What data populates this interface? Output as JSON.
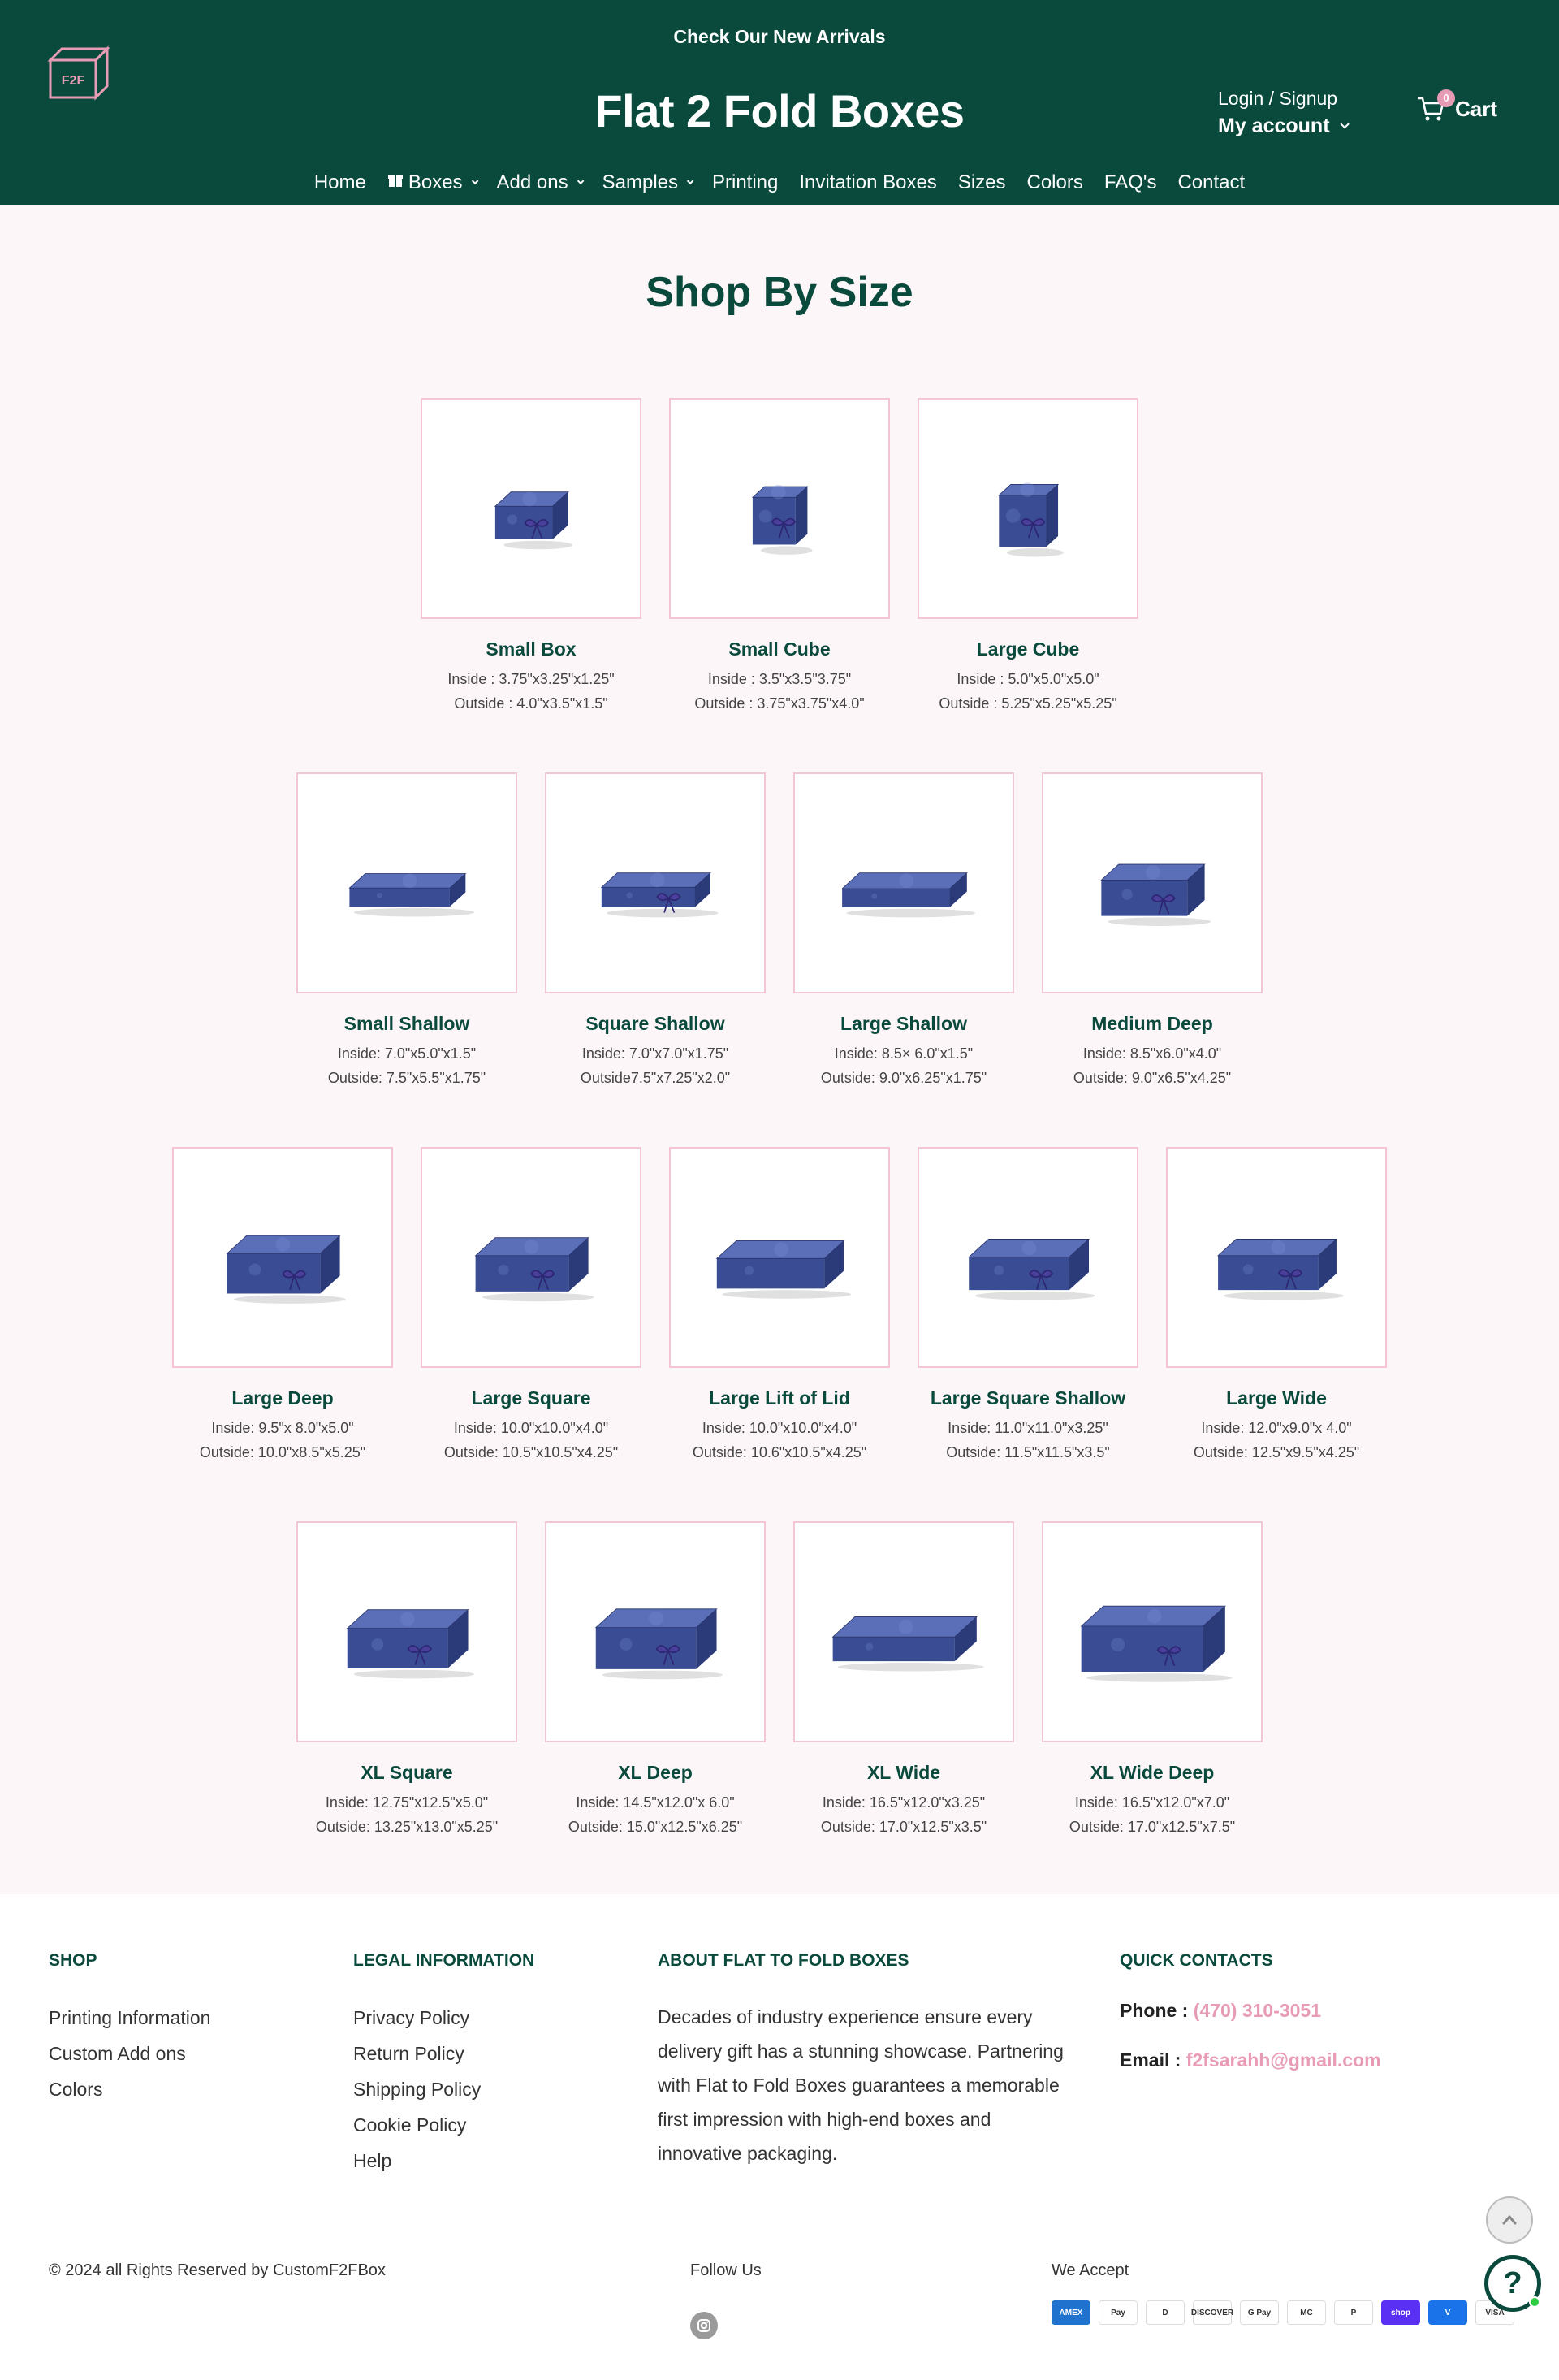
{
  "header": {
    "announcement": "Check Our New Arrivals",
    "logo_text": "F2F",
    "brand": "Flat 2 Fold Boxes",
    "login": "Login / Signup",
    "my_account": "My account",
    "cart_label": "Cart",
    "cart_count": "0"
  },
  "nav": [
    "Home",
    "Boxes",
    "Add ons",
    "Samples",
    "Printing",
    "Invitation Boxes",
    "Sizes",
    "Colors",
    "FAQ's",
    "Contact"
  ],
  "main": {
    "title": "Shop By Size",
    "products": [
      {
        "name": "Small Box",
        "inside": "Inside : 3.75\"x3.25\"x1.25\"",
        "outside": "Outside : 4.0\"x3.5\"x1.5\""
      },
      {
        "name": "Small Cube",
        "inside": "Inside : 3.5\"x3.5\"3.75\"",
        "outside": "Outside : 3.75\"x3.75\"x4.0\""
      },
      {
        "name": "Large Cube",
        "inside": "Inside : 5.0\"x5.0\"x5.0\"",
        "outside": "Outside : 5.25\"x5.25\"x5.25\""
      },
      {
        "name": "Small Shallow",
        "inside": "Inside: 7.0\"x5.0\"x1.5\"",
        "outside": "Outside: 7.5\"x5.5\"x1.75\""
      },
      {
        "name": "Square Shallow",
        "inside": "Inside: 7.0\"x7.0\"x1.75\"",
        "outside": "Outside7.5\"x7.25\"x2.0\""
      },
      {
        "name": "Large Shallow",
        "inside": "Inside: 8.5× 6.0\"x1.5\"",
        "outside": "Outside: 9.0\"x6.25\"x1.75\""
      },
      {
        "name": "Medium Deep",
        "inside": "Inside: 8.5\"x6.0\"x4.0\"",
        "outside": "Outside: 9.0\"x6.5\"x4.25\""
      },
      {
        "name": "Large Deep",
        "inside": "Inside: 9.5\"x 8.0\"x5.0\"",
        "outside": "Outside: 10.0\"x8.5\"x5.25\""
      },
      {
        "name": "Large Square",
        "inside": "Inside: 10.0\"x10.0\"x4.0\"",
        "outside": "Outside: 10.5\"x10.5\"x4.25\""
      },
      {
        "name": "Large Lift of Lid",
        "inside": "Inside: 10.0\"x10.0\"x4.0\"",
        "outside": "Outside: 10.6\"x10.5\"x4.25\""
      },
      {
        "name": "Large Square Shallow",
        "inside": "Inside: 11.0\"x11.0\"x3.25\"",
        "outside": "Outside: 11.5\"x11.5\"x3.5\""
      },
      {
        "name": "Large Wide",
        "inside": "Inside: 12.0\"x9.0\"x 4.0\"",
        "outside": "Outside: 12.5\"x9.5\"x4.25\""
      },
      {
        "name": "XL Square",
        "inside": "Inside: 12.75\"x12.5\"x5.0\"",
        "outside": "Outside: 13.25\"x13.0\"x5.25\""
      },
      {
        "name": "XL Deep",
        "inside": "Inside: 14.5\"x12.0\"x 6.0\"",
        "outside": "Outside: 15.0\"x12.5\"x6.25\""
      },
      {
        "name": "XL Wide",
        "inside": "Inside: 16.5\"x12.0\"x3.25\"",
        "outside": "Outside: 17.0\"x12.5\"x3.5\""
      },
      {
        "name": "XL Wide Deep",
        "inside": "Inside: 16.5\"x12.0\"x7.0\"",
        "outside": "Outside: 17.0\"x12.5\"x7.5\""
      }
    ]
  },
  "footer": {
    "shop_heading": "SHOP",
    "shop_links": [
      "Printing Information",
      "Custom Add ons",
      "Colors"
    ],
    "legal_heading": "LEGAL INFORMATION",
    "legal_links": [
      "Privacy Policy",
      "Return Policy",
      "Shipping Policy",
      "Cookie Policy",
      "Help"
    ],
    "about_heading": "ABOUT FLAT TO FOLD BOXES",
    "about_text": "Decades of industry experience ensure every delivery gift has a stunning showcase. Partnering with Flat to Fold Boxes guarantees a memorable first impression with high-end boxes and innovative packaging.",
    "contact_heading": "QUICK CONTACTS",
    "phone_label": "Phone :",
    "phone": "(470) 310-3051",
    "email_label": "Email :",
    "email": "f2fsarahh@gmail.com",
    "copyright": "© 2024 all Rights Reserved by CustomF2FBox",
    "follow": "Follow Us",
    "accept": "We Accept",
    "payments": [
      "AMEX",
      "Pay",
      "D",
      "DISCOVER",
      "G Pay",
      "MC",
      "P",
      "shop",
      "V",
      "VISA"
    ]
  },
  "colors": {
    "brand_green": "#0a4a3c",
    "accent_pink": "#e89bb4",
    "box_blue": "#3a4d94"
  }
}
